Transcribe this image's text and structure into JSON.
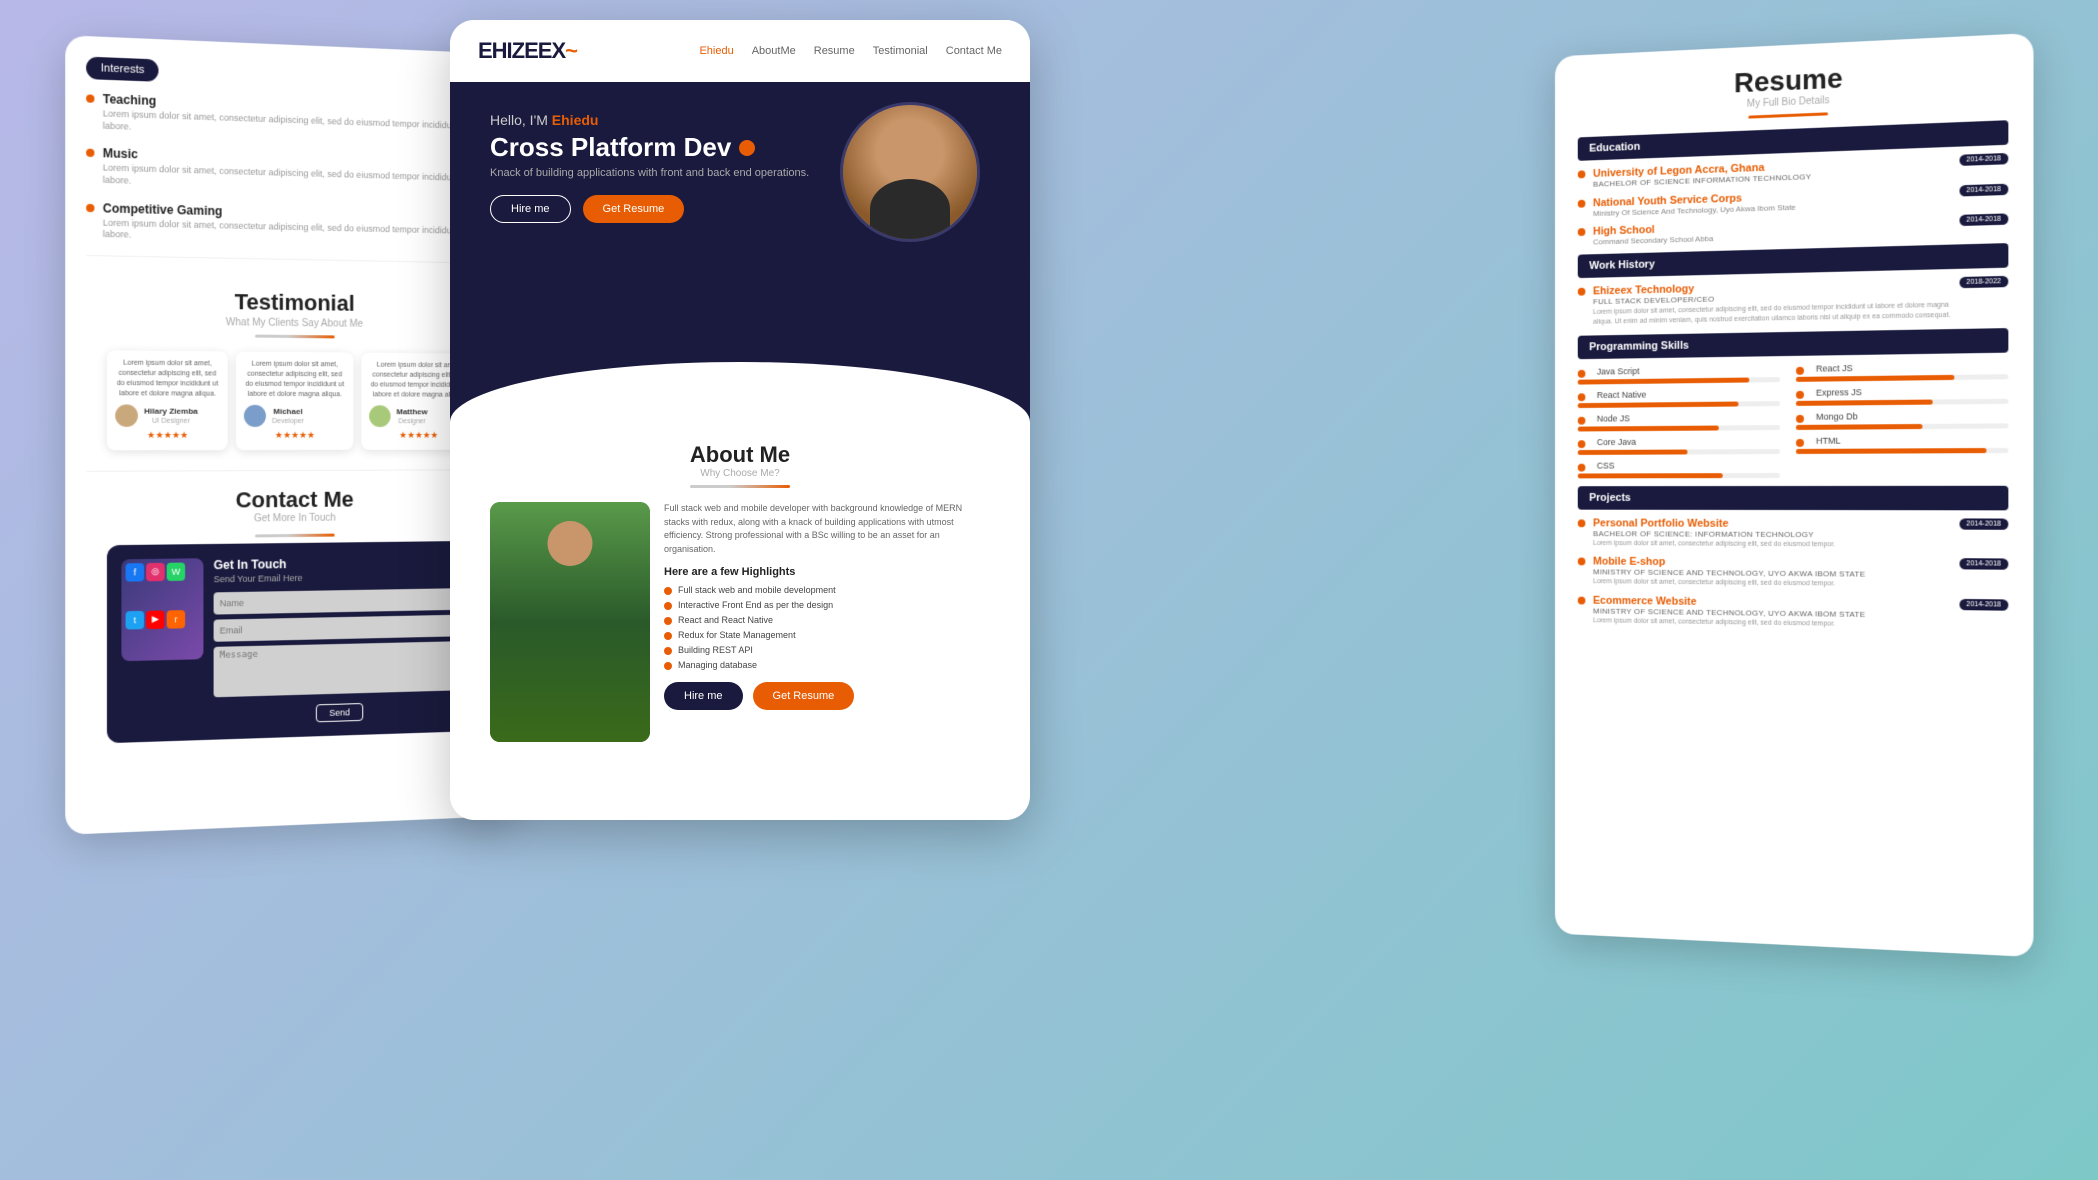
{
  "background": {
    "gradient_start": "#b8b8e8",
    "gradient_end": "#7ec8c8"
  },
  "left_card": {
    "interests_badge": "Interests",
    "interests": [
      {
        "title": "Teaching",
        "desc": "Lorem ipsum dolor sit amet, consectetur adipiscing elit, sed do eiusmod tempor incididunt ut labore."
      },
      {
        "title": "Music",
        "desc": "Lorem ipsum dolor sit amet, consectetur adipiscing elit, sed do eiusmod tempor incididunt ut labore."
      },
      {
        "title": "Competitive Gaming",
        "desc": "Lorem ipsum dolor sit amet, consectetur adipiscing elit, sed do eiusmod tempor incididunt ut labore."
      }
    ],
    "testimonial_title": "Testimonial",
    "testimonial_sub": "What My Clients Say About Me",
    "testimonials": [
      {
        "text": "Lorem ipsum dolor sit amet, consectetur adipiscing elit, sed do eiusmod tempor incididunt ut labore et dolore magna aliqua.",
        "name": "Hilary Ziemba",
        "role": "UI Designer",
        "stars": "★★★★★"
      },
      {
        "text": "Lorem ipsum dolor sit amet, consectetur adipiscing elit, sed do eiusmod tempor incididunt ut labore et dolore magna aliqua.",
        "name": "Michael",
        "role": "Developer",
        "stars": "★★★★★"
      },
      {
        "text": "Lorem ipsum dolor sit amet, consectetur adipiscing elit, sed do eiusmod tempor incididunt ut labore et dolore magna aliqua.",
        "name": "Matthew",
        "role": "Designer",
        "stars": "★★★★★"
      }
    ],
    "contact_title": "Contact Me",
    "contact_sub": "Get More In Touch",
    "get_in_touch_title": "Get In Touch",
    "get_in_touch_sub": "Send Your Email Here",
    "form": {
      "name_placeholder": "Name",
      "email_placeholder": "Email",
      "message_placeholder": "Message",
      "submit_label": "Send"
    }
  },
  "center_card": {
    "brand": "EHIZEEX~",
    "nav_links": [
      {
        "label": "Ehiedu",
        "active": true
      },
      {
        "label": "AboutMe",
        "active": false
      },
      {
        "label": "Resume",
        "active": false
      },
      {
        "label": "Testimonial",
        "active": false
      },
      {
        "label": "Contact Me",
        "active": false
      }
    ],
    "hero": {
      "greeting": "Hello, I'M",
      "name": "Ehiedu",
      "title": "Cross Platform Dev",
      "description": "Knack of building applications with front and back end operations.",
      "btn_hire": "Hire me",
      "btn_resume": "Get Resume"
    },
    "about": {
      "title": "About Me",
      "sub": "Why Choose Me?",
      "description": "Full stack web and mobile developer with background knowledge of MERN stacks with redux, along with a knack of building applications with utmost efficiency. Strong professional with a BSc willing to be an asset for an organisation.",
      "highlights_title": "Here are a few Highlights",
      "highlights": [
        "Full stack web and mobile development",
        "Interactive Front End as per the design",
        "React and React Native",
        "Redux for State Management",
        "Building REST API",
        "Managing database"
      ],
      "btn_hire": "Hire me",
      "btn_resume": "Get Resume"
    }
  },
  "right_card": {
    "title": "Resume",
    "sub": "My Full Bio Details",
    "education_header": "Education",
    "education": [
      {
        "title": "University of Legon Accra, Ghana",
        "degree": "BACHELOR OF SCIENCE INFORMATION TECHNOLOGY",
        "org": "",
        "badge": "2014-2018"
      },
      {
        "title": "National Youth Service Corps",
        "degree": "",
        "org": "Ministry Of Science And Technology, Uyo Akwa Ibom State",
        "badge": "2014-2018"
      },
      {
        "title": "High School",
        "degree": "",
        "org": "Command Secondary School Abba",
        "badge": "2014-2018"
      }
    ],
    "work_history_header": "Work History",
    "work_history": [
      {
        "title": "Ehizeex Technology",
        "degree": "FULL STACK DEVELOPER/CEO",
        "desc": "Lorem ipsum dolor sit amet, consectetur adipiscing elit, sed do eiusmod tempor incididunt ut labore et dolore magna aliqua. Ut enim ad minim veniam, quis nostrud exercitation ullamco laboris nisi ut aliquip ex ea commodo consequat.",
        "badge": "2018-2022"
      }
    ],
    "skills_header": "Programming Skills",
    "skills": [
      {
        "label": "Java Script",
        "pct": 85
      },
      {
        "label": "React JS",
        "pct": 75
      },
      {
        "label": "React Native",
        "pct": 80
      },
      {
        "label": "Express JS",
        "pct": 65
      },
      {
        "label": "Node JS",
        "pct": 70
      },
      {
        "label": "Mongo Db",
        "pct": 60
      },
      {
        "label": "Core Java",
        "pct": 55
      },
      {
        "label": "HTML",
        "pct": 90
      },
      {
        "label": "CSS",
        "pct": 72
      }
    ],
    "projects_header": "Projects",
    "projects": [
      {
        "title": "Personal Portfolio Website",
        "sub": "BACHELOR OF SCIENCE: INFORMATION TECHNOLOGY",
        "desc": "Lorem ipsum dolor sit amet, consectetur adipiscing elit, sed do eiusmod tempor.",
        "badge": "2014-2018"
      },
      {
        "title": "Mobile E-shop",
        "sub": "Ministry Of Science And Technology, Uyo Akwa Ibom State",
        "desc": "Lorem ipsum dolor sit amet, consectetur adipiscing elit, sed do eiusmod tempor.",
        "badge": "2014-2018"
      },
      {
        "title": "Ecommerce Website",
        "sub": "Ministry Of Science And Technology, Uyo Akwa Ibom State",
        "desc": "Lorem ipsum dolor sit amet, consectetur adipiscing elit, sed do eiusmod tempor.",
        "badge": "2014-2018"
      }
    ]
  }
}
